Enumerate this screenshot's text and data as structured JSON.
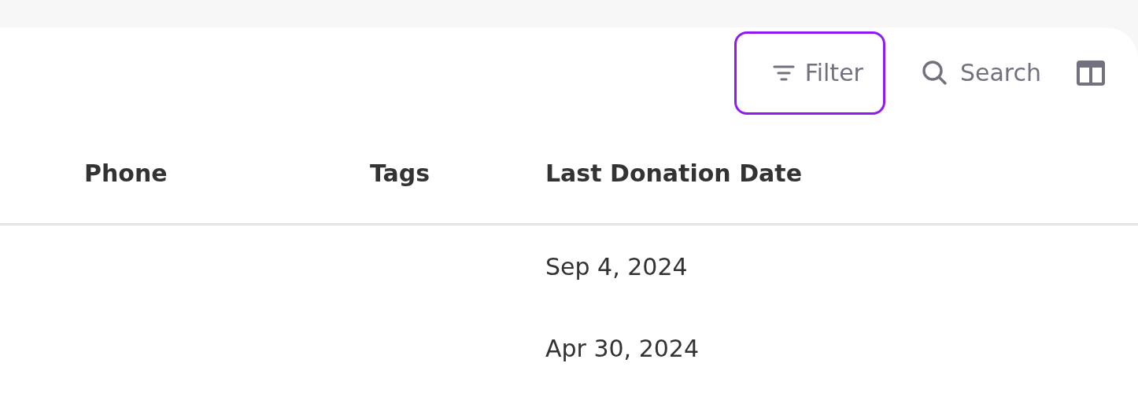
{
  "toolbar": [
    {
      "kind": "filter",
      "label": "Filter",
      "selected": true
    },
    {
      "kind": "search",
      "label": "Search",
      "selected": false
    },
    {
      "kind": "columns",
      "selected": false
    }
  ],
  "table": {
    "columns": [
      "Phone",
      "Tags",
      "Last Donation Date"
    ],
    "rows": [
      {
        "last_donation_date": "Sep 4, 2024"
      },
      {
        "last_donation_date": "Apr 30, 2024"
      }
    ]
  }
}
